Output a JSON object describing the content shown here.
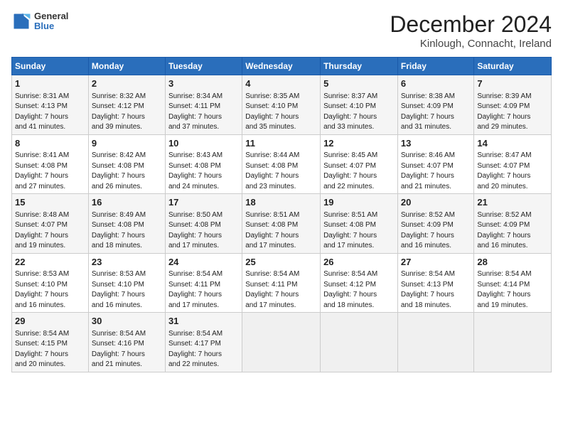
{
  "header": {
    "logo_line1": "General",
    "logo_line2": "Blue",
    "title": "December 2024",
    "subtitle": "Kinlough, Connacht, Ireland"
  },
  "days_of_week": [
    "Sunday",
    "Monday",
    "Tuesday",
    "Wednesday",
    "Thursday",
    "Friday",
    "Saturday"
  ],
  "weeks": [
    [
      {
        "day": "1",
        "info": "Sunrise: 8:31 AM\nSunset: 4:13 PM\nDaylight: 7 hours\nand 41 minutes."
      },
      {
        "day": "2",
        "info": "Sunrise: 8:32 AM\nSunset: 4:12 PM\nDaylight: 7 hours\nand 39 minutes."
      },
      {
        "day": "3",
        "info": "Sunrise: 8:34 AM\nSunset: 4:11 PM\nDaylight: 7 hours\nand 37 minutes."
      },
      {
        "day": "4",
        "info": "Sunrise: 8:35 AM\nSunset: 4:10 PM\nDaylight: 7 hours\nand 35 minutes."
      },
      {
        "day": "5",
        "info": "Sunrise: 8:37 AM\nSunset: 4:10 PM\nDaylight: 7 hours\nand 33 minutes."
      },
      {
        "day": "6",
        "info": "Sunrise: 8:38 AM\nSunset: 4:09 PM\nDaylight: 7 hours\nand 31 minutes."
      },
      {
        "day": "7",
        "info": "Sunrise: 8:39 AM\nSunset: 4:09 PM\nDaylight: 7 hours\nand 29 minutes."
      }
    ],
    [
      {
        "day": "8",
        "info": "Sunrise: 8:41 AM\nSunset: 4:08 PM\nDaylight: 7 hours\nand 27 minutes."
      },
      {
        "day": "9",
        "info": "Sunrise: 8:42 AM\nSunset: 4:08 PM\nDaylight: 7 hours\nand 26 minutes."
      },
      {
        "day": "10",
        "info": "Sunrise: 8:43 AM\nSunset: 4:08 PM\nDaylight: 7 hours\nand 24 minutes."
      },
      {
        "day": "11",
        "info": "Sunrise: 8:44 AM\nSunset: 4:08 PM\nDaylight: 7 hours\nand 23 minutes."
      },
      {
        "day": "12",
        "info": "Sunrise: 8:45 AM\nSunset: 4:07 PM\nDaylight: 7 hours\nand 22 minutes."
      },
      {
        "day": "13",
        "info": "Sunrise: 8:46 AM\nSunset: 4:07 PM\nDaylight: 7 hours\nand 21 minutes."
      },
      {
        "day": "14",
        "info": "Sunrise: 8:47 AM\nSunset: 4:07 PM\nDaylight: 7 hours\nand 20 minutes."
      }
    ],
    [
      {
        "day": "15",
        "info": "Sunrise: 8:48 AM\nSunset: 4:07 PM\nDaylight: 7 hours\nand 19 minutes."
      },
      {
        "day": "16",
        "info": "Sunrise: 8:49 AM\nSunset: 4:08 PM\nDaylight: 7 hours\nand 18 minutes."
      },
      {
        "day": "17",
        "info": "Sunrise: 8:50 AM\nSunset: 4:08 PM\nDaylight: 7 hours\nand 17 minutes."
      },
      {
        "day": "18",
        "info": "Sunrise: 8:51 AM\nSunset: 4:08 PM\nDaylight: 7 hours\nand 17 minutes."
      },
      {
        "day": "19",
        "info": "Sunrise: 8:51 AM\nSunset: 4:08 PM\nDaylight: 7 hours\nand 17 minutes."
      },
      {
        "day": "20",
        "info": "Sunrise: 8:52 AM\nSunset: 4:09 PM\nDaylight: 7 hours\nand 16 minutes."
      },
      {
        "day": "21",
        "info": "Sunrise: 8:52 AM\nSunset: 4:09 PM\nDaylight: 7 hours\nand 16 minutes."
      }
    ],
    [
      {
        "day": "22",
        "info": "Sunrise: 8:53 AM\nSunset: 4:10 PM\nDaylight: 7 hours\nand 16 minutes."
      },
      {
        "day": "23",
        "info": "Sunrise: 8:53 AM\nSunset: 4:10 PM\nDaylight: 7 hours\nand 16 minutes."
      },
      {
        "day": "24",
        "info": "Sunrise: 8:54 AM\nSunset: 4:11 PM\nDaylight: 7 hours\nand 17 minutes."
      },
      {
        "day": "25",
        "info": "Sunrise: 8:54 AM\nSunset: 4:11 PM\nDaylight: 7 hours\nand 17 minutes."
      },
      {
        "day": "26",
        "info": "Sunrise: 8:54 AM\nSunset: 4:12 PM\nDaylight: 7 hours\nand 18 minutes."
      },
      {
        "day": "27",
        "info": "Sunrise: 8:54 AM\nSunset: 4:13 PM\nDaylight: 7 hours\nand 18 minutes."
      },
      {
        "day": "28",
        "info": "Sunrise: 8:54 AM\nSunset: 4:14 PM\nDaylight: 7 hours\nand 19 minutes."
      }
    ],
    [
      {
        "day": "29",
        "info": "Sunrise: 8:54 AM\nSunset: 4:15 PM\nDaylight: 7 hours\nand 20 minutes."
      },
      {
        "day": "30",
        "info": "Sunrise: 8:54 AM\nSunset: 4:16 PM\nDaylight: 7 hours\nand 21 minutes."
      },
      {
        "day": "31",
        "info": "Sunrise: 8:54 AM\nSunset: 4:17 PM\nDaylight: 7 hours\nand 22 minutes."
      },
      null,
      null,
      null,
      null
    ]
  ]
}
